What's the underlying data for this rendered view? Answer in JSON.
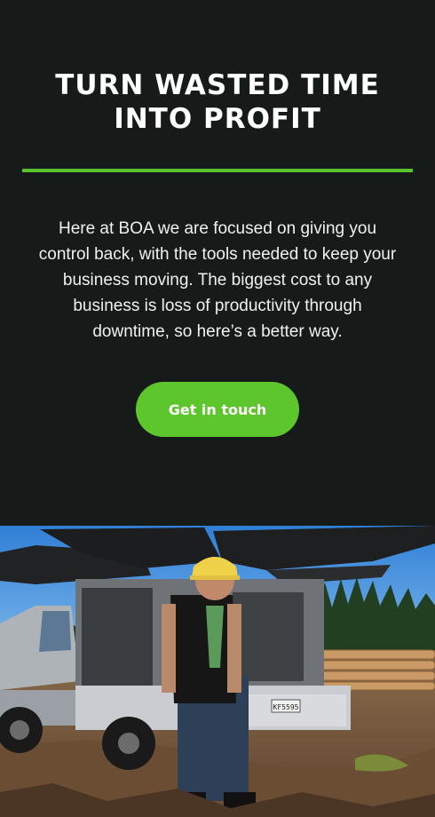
{
  "hero": {
    "headline_lines": [
      "TURN WASTED TIME",
      "INTO PROFIT"
    ],
    "intro_lines": [
      "Here at BOA we are focused on giving you",
      "control back, with the tools needed to keep your",
      "business moving. The biggest cost to any",
      "business is loss of productivity through",
      "downtime, so here’s a better way."
    ],
    "cta_label": "Get in touch",
    "accent_color": "#58c12c",
    "background_color": "#161a19"
  },
  "photo": {
    "plate_text": "KF5595",
    "alt": "Worker in hard hat beside service ute with open canopy in forest clearing"
  }
}
